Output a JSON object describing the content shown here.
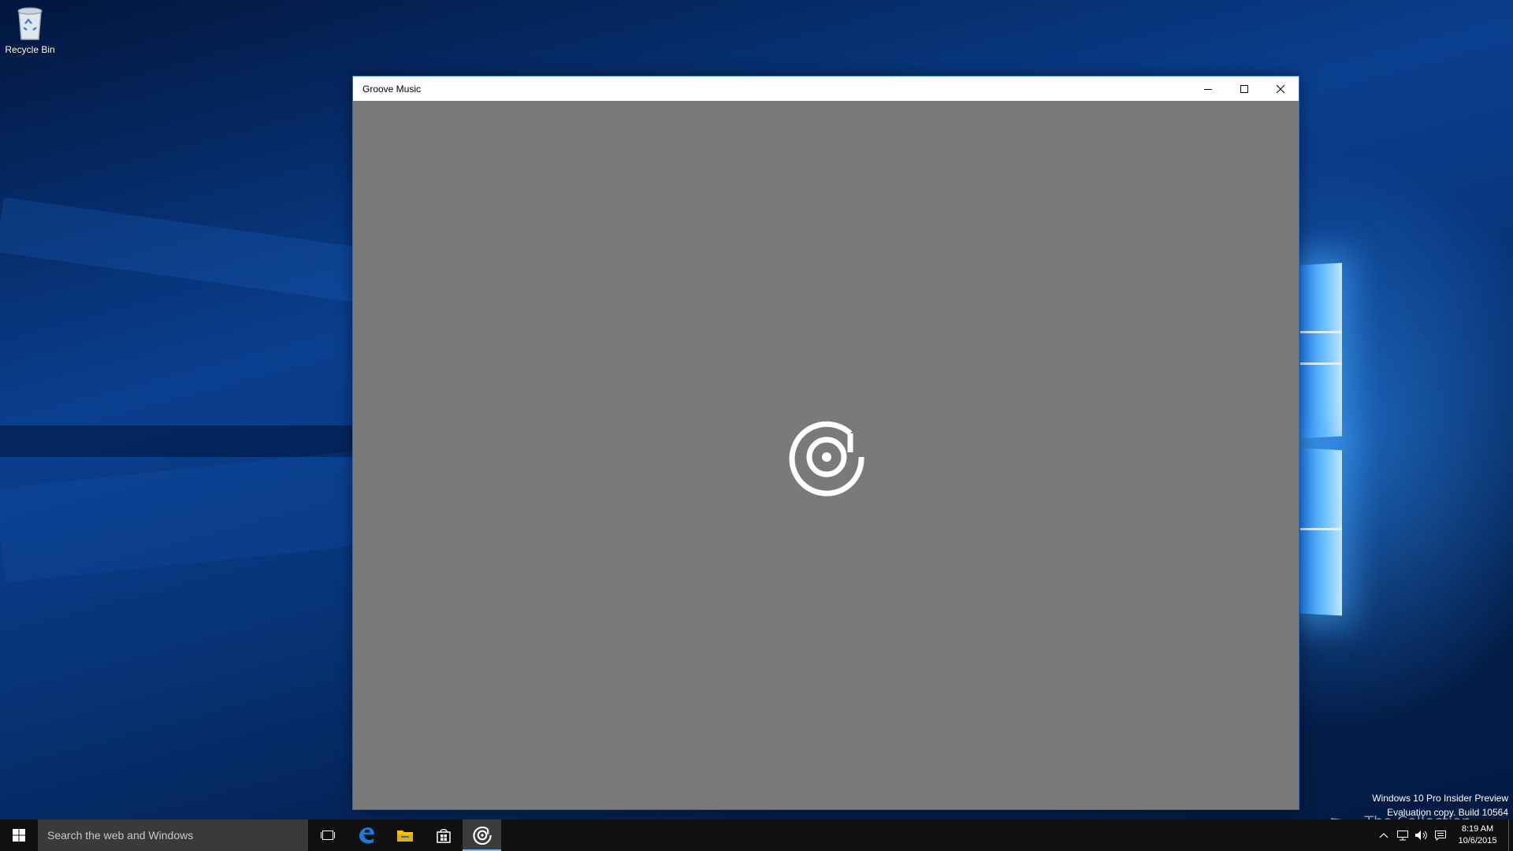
{
  "desktop": {
    "icons": [
      {
        "label": "Recycle Bin",
        "icon": "recycle-bin-icon"
      }
    ]
  },
  "window": {
    "title": "Groove Music",
    "controls": {
      "minimize": "minimize-icon",
      "maximize": "maximize-icon",
      "close": "close-icon"
    },
    "splash_icon": "groove-music-icon",
    "background_color": "#7a7a7a",
    "border_color": "#2b6ec4"
  },
  "watermark": {
    "line1": "Windows 10 Pro Insider Preview",
    "line2": "Evaluation copy. Build 10564",
    "site_label": "The Collection Book"
  },
  "taskbar": {
    "search_placeholder": "Search the web and Windows",
    "pinned": [
      {
        "name": "task-view",
        "icon": "task-view-icon"
      },
      {
        "name": "edge",
        "icon": "edge-icon",
        "color": "#1e7ad6"
      },
      {
        "name": "file-explorer",
        "icon": "folder-icon",
        "color": "#f1c40f"
      },
      {
        "name": "store",
        "icon": "store-icon"
      },
      {
        "name": "groove-music",
        "icon": "groove-music-icon",
        "active": true
      }
    ],
    "tray": {
      "icons": [
        "chevron-up-icon",
        "network-icon",
        "volume-icon",
        "action-center-icon"
      ],
      "time": "8:19 AM",
      "date": "10/6/2015"
    },
    "accent_color": "#78b4f0"
  }
}
